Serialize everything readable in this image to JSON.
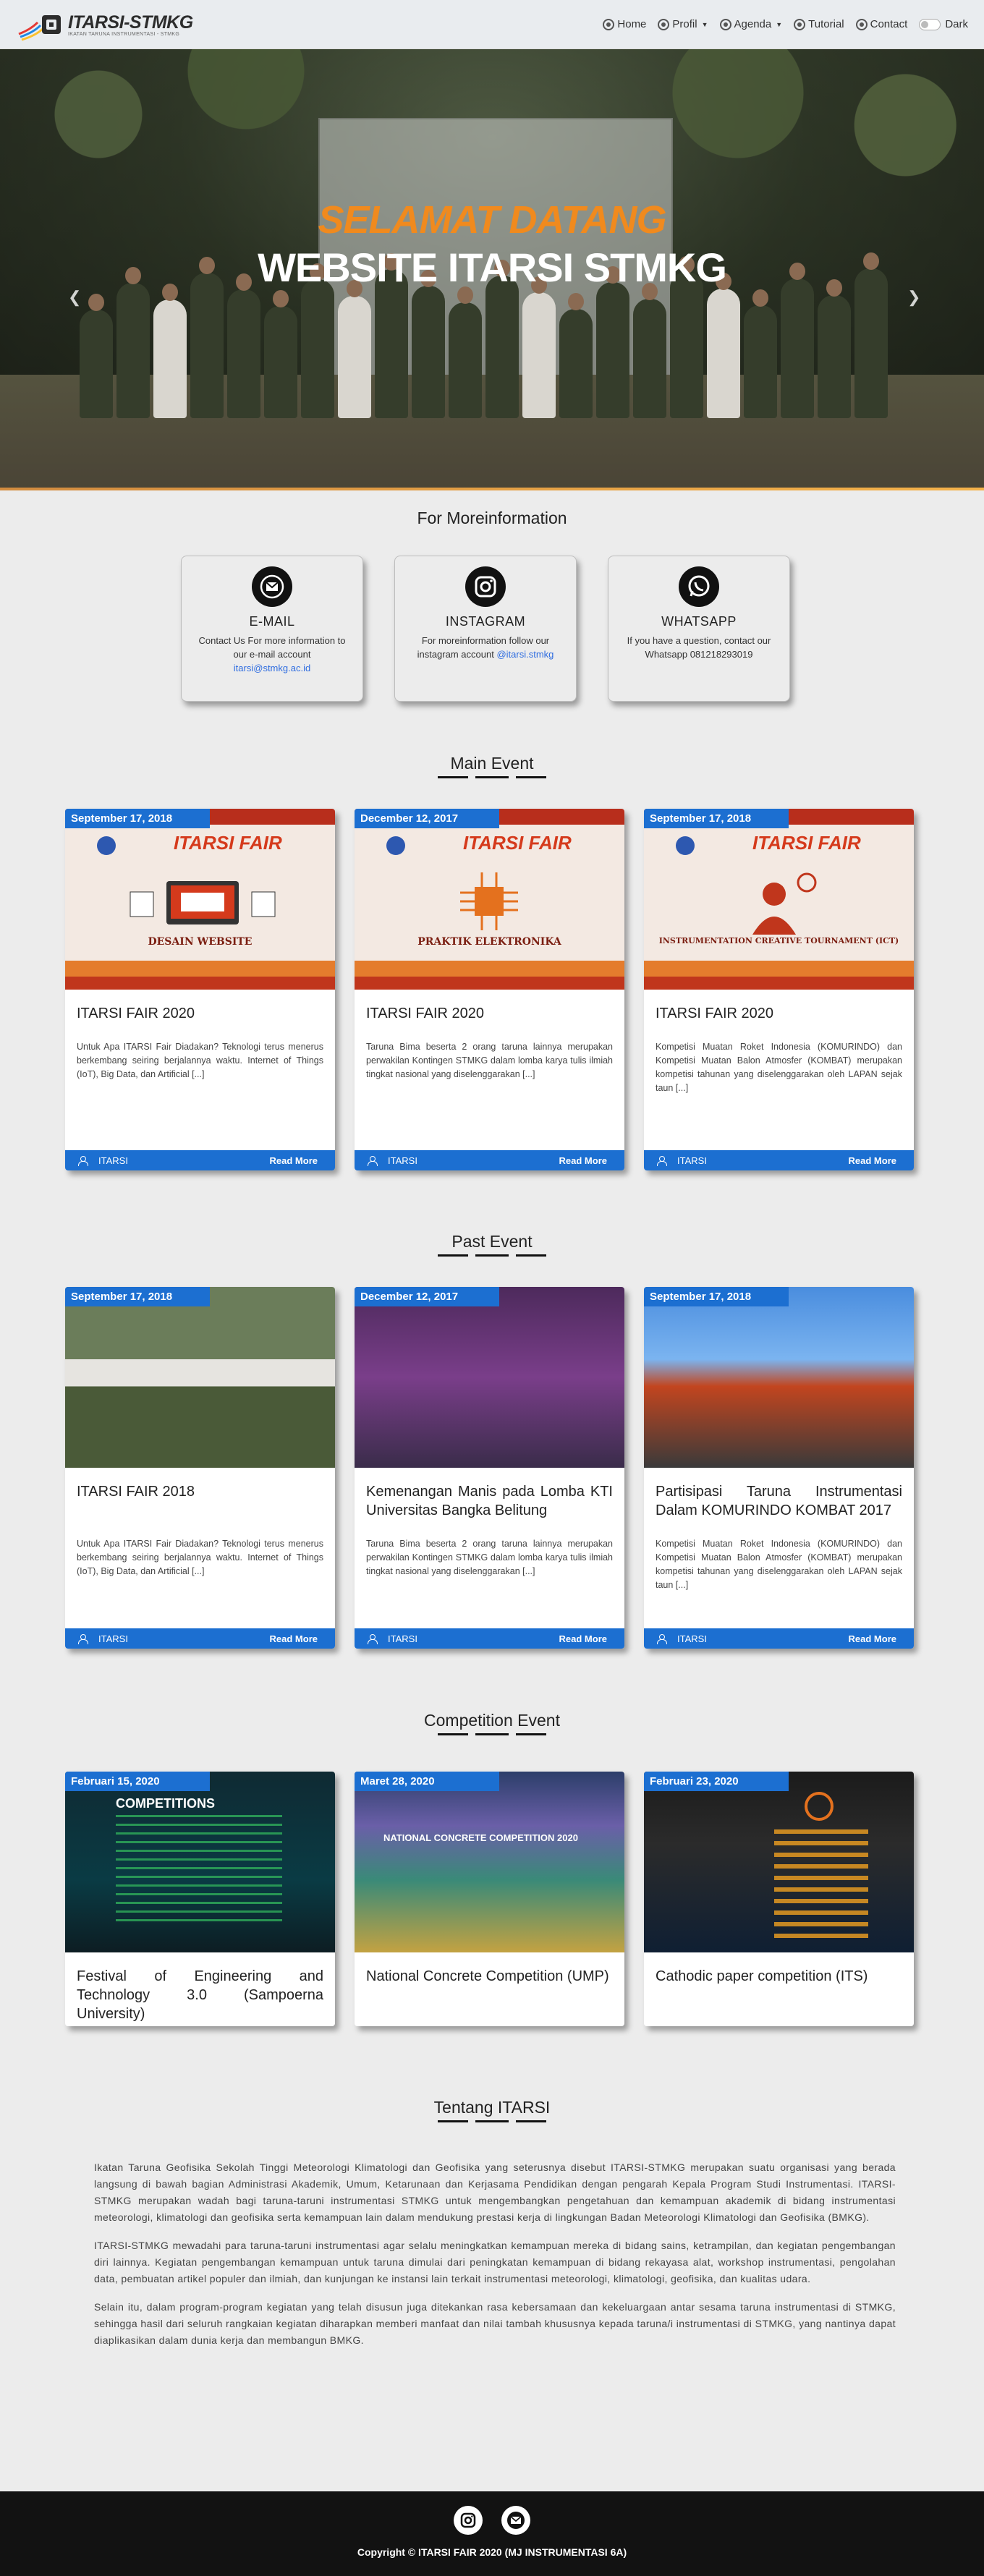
{
  "nav": {
    "brand_title": "ITARSI-STMKG",
    "brand_sub": "IKATAN TARUNA INSTRUMENTASI - STMKG",
    "items": [
      {
        "label": "Home",
        "icon": "home-icon",
        "dropdown": false
      },
      {
        "label": "Profil",
        "icon": "profile-icon",
        "dropdown": true
      },
      {
        "label": "Agenda",
        "icon": "calendar-icon",
        "dropdown": true
      },
      {
        "label": "Tutorial",
        "icon": "book-icon",
        "dropdown": false
      },
      {
        "label": "Contact",
        "icon": "phone-icon",
        "dropdown": false
      }
    ],
    "dark_label": "Dark"
  },
  "hero": {
    "line1": "SELAMAT DATANG",
    "line2": "WEBSITE ITARSI STMKG",
    "active_slide": 1,
    "slide_count": 3
  },
  "info": {
    "title": "For Moreinformation",
    "cards": [
      {
        "icon": "email-icon",
        "label": "E-MAIL",
        "desc": "Contact Us For more information to our e-mail account",
        "highlight": "itarsi@stmkg.ac.id"
      },
      {
        "icon": "instagram-icon",
        "label": "INSTAGRAM",
        "desc": "For moreinformation follow our instagram account",
        "highlight": "@itarsi.stmkg"
      },
      {
        "icon": "whatsapp-icon",
        "label": "WHATSAPP",
        "desc": "If you have a question, contact our Whatsapp 081218293019",
        "highlight": ""
      }
    ]
  },
  "main_event": {
    "title": "Main Event",
    "cards": [
      {
        "date": "September 17, 2018",
        "title": "ITARSI FAIR 2020",
        "caption": "DESAIN WEBSITE",
        "text": "Untuk Apa ITARSI Fair Diadakan? Teknologi terus menerus berkembang seiring berjalannya waktu. Internet of Things (IoT), Big Data, dan Artificial [...]",
        "author": "ITARSI",
        "more": "Read More"
      },
      {
        "date": "December 12, 2017",
        "title": "ITARSI FAIR 2020",
        "caption": "PRAKTIK ELEKTRONIKA",
        "text": "Taruna Bima beserta 2 orang taruna lainnya merupakan perwakilan Kontingen STMKG dalam lomba karya tulis ilmiah tingkat nasional yang diselenggarakan [...]",
        "author": "ITARSI",
        "more": "Read More"
      },
      {
        "date": "September 17, 2018",
        "title": "ITARSI FAIR 2020",
        "caption": "INSTRUMENTATION CREATIVE TOURNAMENT (ICT)",
        "text": "Kompetisi Muatan Roket Indonesia (KOMURINDO) dan Kompetisi Muatan Balon Atmosfer (KOMBAT) merupakan kompetisi tahunan yang diselenggarakan oleh LAPAN sejak taun [...]",
        "author": "ITARSI",
        "more": "Read More"
      }
    ]
  },
  "past_event": {
    "title": "Past Event",
    "cards": [
      {
        "date": "September 17, 2018",
        "title": "ITARSI FAIR 2018",
        "text": "Untuk Apa ITARSI Fair Diadakan? Teknologi terus menerus berkembang seiring berjalannya waktu. Internet of Things (IoT), Big Data, dan Artificial [...]",
        "author": "ITARSI",
        "more": "Read More"
      },
      {
        "date": "December 12, 2017",
        "title": "Kemenangan Manis pada Lomba KTI Universitas Bangka Belitung",
        "text": "Taruna Bima beserta 2 orang taruna lainnya merupakan perwakilan Kontingen STMKG dalam lomba karya tulis ilmiah tingkat nasional yang diselenggarakan [...]",
        "author": "ITARSI",
        "more": "Read More"
      },
      {
        "date": "September 17, 2018",
        "title": "Partisipasi Taruna Instrumentasi Dalam KOMURINDO KOMBAT 2017",
        "text": "Kompetisi Muatan Roket Indonesia (KOMURINDO) dan Kompetisi Muatan Balon Atmosfer (KOMBAT) merupakan kompetisi tahunan yang diselenggarakan oleh LAPAN sejak taun [...]",
        "author": "ITARSI",
        "more": "Read More"
      }
    ]
  },
  "competition_event": {
    "title": "Competition Event",
    "cards": [
      {
        "date": "Februari 15, 2020",
        "title": "Festival of Engineering and Technology 3.0 (Sampoerna University)",
        "poster": "COMPETITIONS"
      },
      {
        "date": "Maret 28, 2020",
        "title": "National Concrete Competition (UMP)",
        "poster": "NATIONAL CONCRETE COMPETITION 2020"
      },
      {
        "date": "Februari 23, 2020",
        "title": "Cathodic paper competition (ITS)",
        "poster": ""
      }
    ]
  },
  "about": {
    "title": "Tentang ITARSI",
    "paragraphs": [
      "Ikatan Taruna Geofisika Sekolah Tinggi Meteorologi Klimatologi dan Geofisika yang seterusnya disebut ITARSI-STMKG merupakan suatu organisasi yang berada langsung di bawah bagian Administrasi Akademik, Umum, Ketarunaan dan Kerjasama Pendidikan dengan pengarah Kepala Program Studi Instrumentasi. ITARSI-STMKG merupakan wadah bagi taruna-taruni instrumentasi STMKG untuk mengembangkan pengetahuan dan kemampuan akademik di bidang instrumentasi meteorologi, klimatologi dan geofisika serta kemampuan lain dalam mendukung prestasi kerja di lingkungan Badan Meteorologi Klimatologi dan Geofisika (BMKG).",
      "ITARSI-STMKG mewadahi para taruna-taruni instrumentasi agar selalu meningkatkan kemampuan mereka di bidang sains, ketrampilan, dan kegiatan pengembangan diri lainnya. Kegiatan pengembangan kemampuan untuk taruna dimulai dari peningkatan kemampuan di bidang rekayasa alat, workshop instrumentasi, pengolahan data, pembuatan artikel populer dan ilmiah, dan kunjungan ke instansi lain terkait instrumentasi meteorologi, klimatologi, geofisika, dan kualitas udara.",
      "Selain itu, dalam program-program kegiatan yang telah disusun juga ditekankan rasa kebersamaan dan kekeluargaan antar sesama taruna instrumentasi di STMKG, sehingga hasil dari seluruh rangkaian kegiatan diharapkan memberi manfaat dan nilai tambah khususnya kepada taruna/i instrumentasi di STMKG, yang nantinya dapat diaplikasikan dalam dunia kerja dan membangun BMKG."
    ]
  },
  "footer": {
    "copyright": "Copyright © ITARSI FAIR 2020 (MJ INSTRUMENTASI 6A)"
  },
  "colors": {
    "accent_blue": "#1c6fd1",
    "hero_orange": "#f08a1e",
    "footer_bg": "#121212"
  }
}
